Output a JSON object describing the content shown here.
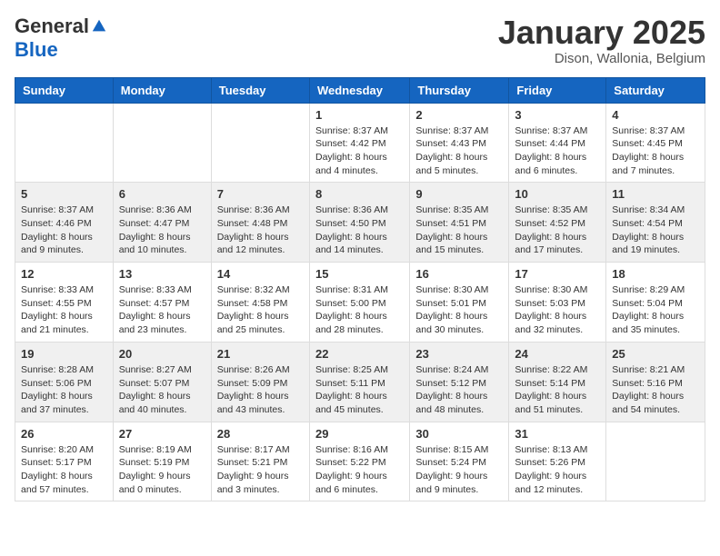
{
  "header": {
    "logo_general": "General",
    "logo_blue": "Blue",
    "month_title": "January 2025",
    "location": "Dison, Wallonia, Belgium"
  },
  "days_of_week": [
    "Sunday",
    "Monday",
    "Tuesday",
    "Wednesday",
    "Thursday",
    "Friday",
    "Saturday"
  ],
  "weeks": [
    [
      {
        "day": "",
        "info": ""
      },
      {
        "day": "",
        "info": ""
      },
      {
        "day": "",
        "info": ""
      },
      {
        "day": "1",
        "info": "Sunrise: 8:37 AM\nSunset: 4:42 PM\nDaylight: 8 hours\nand 4 minutes."
      },
      {
        "day": "2",
        "info": "Sunrise: 8:37 AM\nSunset: 4:43 PM\nDaylight: 8 hours\nand 5 minutes."
      },
      {
        "day": "3",
        "info": "Sunrise: 8:37 AM\nSunset: 4:44 PM\nDaylight: 8 hours\nand 6 minutes."
      },
      {
        "day": "4",
        "info": "Sunrise: 8:37 AM\nSunset: 4:45 PM\nDaylight: 8 hours\nand 7 minutes."
      }
    ],
    [
      {
        "day": "5",
        "info": "Sunrise: 8:37 AM\nSunset: 4:46 PM\nDaylight: 8 hours\nand 9 minutes."
      },
      {
        "day": "6",
        "info": "Sunrise: 8:36 AM\nSunset: 4:47 PM\nDaylight: 8 hours\nand 10 minutes."
      },
      {
        "day": "7",
        "info": "Sunrise: 8:36 AM\nSunset: 4:48 PM\nDaylight: 8 hours\nand 12 minutes."
      },
      {
        "day": "8",
        "info": "Sunrise: 8:36 AM\nSunset: 4:50 PM\nDaylight: 8 hours\nand 14 minutes."
      },
      {
        "day": "9",
        "info": "Sunrise: 8:35 AM\nSunset: 4:51 PM\nDaylight: 8 hours\nand 15 minutes."
      },
      {
        "day": "10",
        "info": "Sunrise: 8:35 AM\nSunset: 4:52 PM\nDaylight: 8 hours\nand 17 minutes."
      },
      {
        "day": "11",
        "info": "Sunrise: 8:34 AM\nSunset: 4:54 PM\nDaylight: 8 hours\nand 19 minutes."
      }
    ],
    [
      {
        "day": "12",
        "info": "Sunrise: 8:33 AM\nSunset: 4:55 PM\nDaylight: 8 hours\nand 21 minutes."
      },
      {
        "day": "13",
        "info": "Sunrise: 8:33 AM\nSunset: 4:57 PM\nDaylight: 8 hours\nand 23 minutes."
      },
      {
        "day": "14",
        "info": "Sunrise: 8:32 AM\nSunset: 4:58 PM\nDaylight: 8 hours\nand 25 minutes."
      },
      {
        "day": "15",
        "info": "Sunrise: 8:31 AM\nSunset: 5:00 PM\nDaylight: 8 hours\nand 28 minutes."
      },
      {
        "day": "16",
        "info": "Sunrise: 8:30 AM\nSunset: 5:01 PM\nDaylight: 8 hours\nand 30 minutes."
      },
      {
        "day": "17",
        "info": "Sunrise: 8:30 AM\nSunset: 5:03 PM\nDaylight: 8 hours\nand 32 minutes."
      },
      {
        "day": "18",
        "info": "Sunrise: 8:29 AM\nSunset: 5:04 PM\nDaylight: 8 hours\nand 35 minutes."
      }
    ],
    [
      {
        "day": "19",
        "info": "Sunrise: 8:28 AM\nSunset: 5:06 PM\nDaylight: 8 hours\nand 37 minutes."
      },
      {
        "day": "20",
        "info": "Sunrise: 8:27 AM\nSunset: 5:07 PM\nDaylight: 8 hours\nand 40 minutes."
      },
      {
        "day": "21",
        "info": "Sunrise: 8:26 AM\nSunset: 5:09 PM\nDaylight: 8 hours\nand 43 minutes."
      },
      {
        "day": "22",
        "info": "Sunrise: 8:25 AM\nSunset: 5:11 PM\nDaylight: 8 hours\nand 45 minutes."
      },
      {
        "day": "23",
        "info": "Sunrise: 8:24 AM\nSunset: 5:12 PM\nDaylight: 8 hours\nand 48 minutes."
      },
      {
        "day": "24",
        "info": "Sunrise: 8:22 AM\nSunset: 5:14 PM\nDaylight: 8 hours\nand 51 minutes."
      },
      {
        "day": "25",
        "info": "Sunrise: 8:21 AM\nSunset: 5:16 PM\nDaylight: 8 hours\nand 54 minutes."
      }
    ],
    [
      {
        "day": "26",
        "info": "Sunrise: 8:20 AM\nSunset: 5:17 PM\nDaylight: 8 hours\nand 57 minutes."
      },
      {
        "day": "27",
        "info": "Sunrise: 8:19 AM\nSunset: 5:19 PM\nDaylight: 9 hours\nand 0 minutes."
      },
      {
        "day": "28",
        "info": "Sunrise: 8:17 AM\nSunset: 5:21 PM\nDaylight: 9 hours\nand 3 minutes."
      },
      {
        "day": "29",
        "info": "Sunrise: 8:16 AM\nSunset: 5:22 PM\nDaylight: 9 hours\nand 6 minutes."
      },
      {
        "day": "30",
        "info": "Sunrise: 8:15 AM\nSunset: 5:24 PM\nDaylight: 9 hours\nand 9 minutes."
      },
      {
        "day": "31",
        "info": "Sunrise: 8:13 AM\nSunset: 5:26 PM\nDaylight: 9 hours\nand 12 minutes."
      },
      {
        "day": "",
        "info": ""
      }
    ]
  ]
}
